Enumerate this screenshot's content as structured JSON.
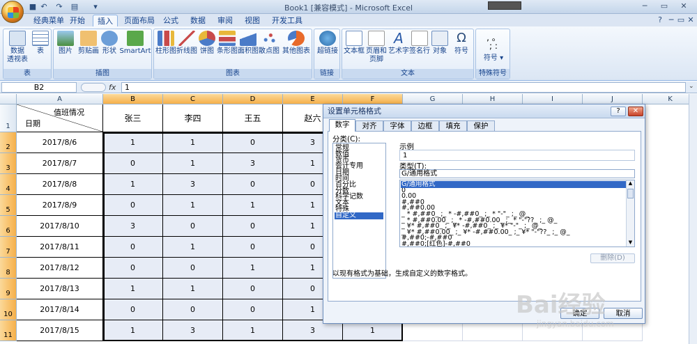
{
  "window": {
    "title": "Book1  [兼容模式] - Microsoft Excel"
  },
  "tabs": [
    "经典菜单",
    "开始",
    "插入",
    "页面布局",
    "公式",
    "数据",
    "审阅",
    "视图",
    "开发工具"
  ],
  "active_tab": "插入",
  "ribbon": {
    "groups": {
      "table": "表",
      "illustrations": "插图",
      "charts": "图表",
      "links": "链接",
      "text": "文本",
      "symbols": "特殊符号"
    },
    "items": {
      "pivot": "数据\n透视表",
      "table": "表",
      "picture": "图片",
      "clipart": "剪贴画",
      "shapes": "形状",
      "smartart": "SmartArt",
      "col": "柱形图",
      "line": "折线图",
      "pie": "饼图",
      "bar": "条形图",
      "area": "面积图",
      "scatter": "散点图",
      "other": "其他图表",
      "hyperlink": "超链接",
      "textbox": "文本框",
      "headerfooter": "页眉和\n页脚",
      "wordart": "艺术字",
      "sigline": "签名行",
      "object": "对象",
      "symbol": "符号",
      "symbol2": "符号"
    }
  },
  "formula": {
    "namebox": "B2",
    "fx": "fx",
    "value": "1"
  },
  "columns": [
    "A",
    "B",
    "C",
    "D",
    "E",
    "F",
    "G",
    "H",
    "I",
    "J",
    "K"
  ],
  "header_cell": {
    "top": "值班情况",
    "bottom": "日期"
  },
  "names": [
    "张三",
    "李四",
    "王五",
    "赵六"
  ],
  "rows": [
    {
      "n": "1"
    },
    {
      "n": "2",
      "date": "2017/8/6",
      "v": [
        "1",
        "1",
        "0",
        "3"
      ]
    },
    {
      "n": "3",
      "date": "2017/8/7",
      "v": [
        "0",
        "1",
        "3",
        "1"
      ]
    },
    {
      "n": "4",
      "date": "2017/8/8",
      "v": [
        "1",
        "3",
        "0",
        "0"
      ]
    },
    {
      "n": "5",
      "date": "2017/8/9",
      "v": [
        "0",
        "1",
        "1",
        "1"
      ]
    },
    {
      "n": "6",
      "date": "2017/8/10",
      "v": [
        "3",
        "0",
        "0",
        "1"
      ]
    },
    {
      "n": "7",
      "date": "2017/8/11",
      "v": [
        "0",
        "1",
        "0",
        "0"
      ]
    },
    {
      "n": "8",
      "date": "2017/8/12",
      "v": [
        "0",
        "0",
        "1",
        "1"
      ]
    },
    {
      "n": "9",
      "date": "2017/8/13",
      "v": [
        "1",
        "1",
        "0",
        "0"
      ]
    },
    {
      "n": "10",
      "date": "2017/8/14",
      "v": [
        "0",
        "0",
        "0",
        "1"
      ]
    },
    {
      "n": "11",
      "date": "2017/8/15",
      "v": [
        "1",
        "3",
        "1",
        "3",
        "1"
      ]
    }
  ],
  "dialog": {
    "title": "设置单元格格式",
    "tabs": [
      "数字",
      "对齐",
      "字体",
      "边框",
      "填充",
      "保护"
    ],
    "category_label": "分类(C):",
    "categories": [
      "常规",
      "数值",
      "货币",
      "会计专用",
      "日期",
      "时间",
      "百分比",
      "分数",
      "科学记数",
      "文本",
      "特殊",
      "自定义"
    ],
    "sample_label": "示例",
    "sample_value": "1",
    "type_label": "类型(T):",
    "type_value": "G/通用格式",
    "formats": [
      "G/通用格式",
      "0",
      "0.00",
      "#,##0",
      "#,##0.00",
      "_ * #,##0_ ;_ * -#,##0_ ;_ * \"-\"_ ;_ @_",
      "_ * #,##0.00_ ;_ * -#,##0.00_ ;_ * \"-\"??_ ;_ @_",
      "_ ¥* #,##0_ ;_ ¥* -#,##0_ ;_ ¥* \"-\"_ ;_ @_",
      "_ ¥* #,##0.00_ ;_ ¥* -#,##0.00_ ;_ ¥* \"-\"??_ ;_ @_",
      "#,##0;-#,##0",
      "#,##0;[红色]-#,##0"
    ],
    "delete_label": "删除(D)",
    "description": "以现有格式为基础，生成自定义的数字格式。",
    "ok": "确定",
    "cancel": "取消"
  },
  "watermark": {
    "brand": "Bai经验",
    "url": "jingyan.baidu.com"
  }
}
